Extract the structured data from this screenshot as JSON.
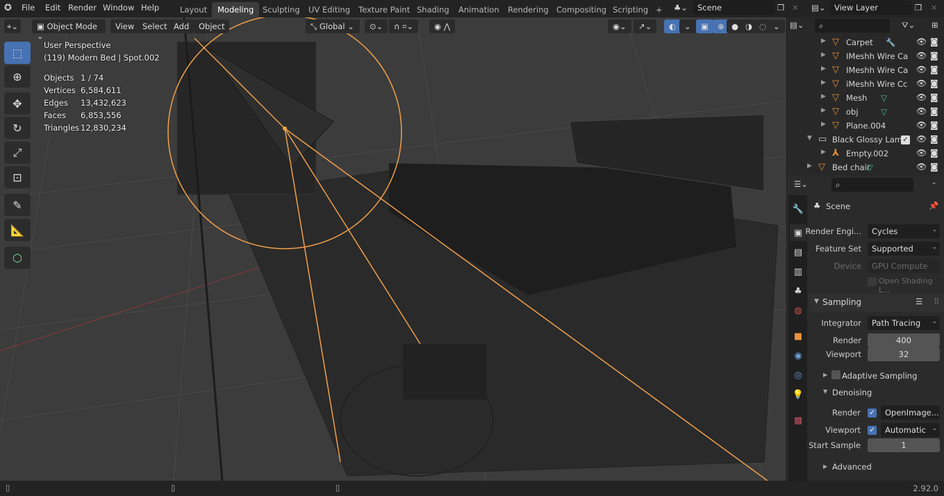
{
  "menu": {
    "items": [
      "File",
      "Edit",
      "Render",
      "Window",
      "Help"
    ]
  },
  "workspaces": {
    "tabs": [
      "Layout",
      "Modeling",
      "Sculpting",
      "UV Editing",
      "Texture Paint",
      "Shading",
      "Animation",
      "Rendering",
      "Compositing",
      "Scripting"
    ],
    "active": "Modeling",
    "add": "+"
  },
  "scene": {
    "name": "Scene",
    "view_layer": "View Layer"
  },
  "viewport_header": {
    "mode": "Object Mode",
    "view": "View",
    "select": "Select",
    "add": "Add",
    "object": "Object",
    "orientation": "Global"
  },
  "overlay": {
    "perspective": "User Perspective",
    "context": "(119) Modern Bed | Spot.002",
    "stats": [
      {
        "label": "Objects",
        "value": "1 / 74"
      },
      {
        "label": "Vertices",
        "value": "6,584,611"
      },
      {
        "label": "Edges",
        "value": "13,432,623"
      },
      {
        "label": "Faces",
        "value": "6,853,556"
      },
      {
        "label": "Triangles",
        "value": "12,830,234"
      }
    ]
  },
  "outliner": {
    "search_placeholder": "",
    "items": [
      {
        "label": "Carpet",
        "type": "mesh",
        "extra": "wrench"
      },
      {
        "label": "IMeshh Wire Ca",
        "type": "mesh"
      },
      {
        "label": "IMeshh Wire Ca",
        "type": "mesh"
      },
      {
        "label": "iMeshh Wire Cc",
        "type": "mesh"
      },
      {
        "label": "Mesh",
        "type": "mesh",
        "extra": "mesh-data"
      },
      {
        "label": "obj",
        "type": "mesh",
        "extra": "mesh-data"
      },
      {
        "label": "Plane.004",
        "type": "mesh"
      },
      {
        "label": "Black Glossy Lamp",
        "type": "collection",
        "checked": true
      },
      {
        "label": "Empty.002",
        "type": "empty"
      },
      {
        "label": "Bed chair",
        "type": "mesh",
        "extra": "mesh-data"
      }
    ]
  },
  "properties": {
    "context": "Scene",
    "render_engine": {
      "label": "Render Engi...",
      "value": "Cycles"
    },
    "feature_set": {
      "label": "Feature Set",
      "value": "Supported"
    },
    "device": {
      "label": "Device",
      "value": "GPU Compute"
    },
    "open_shading": {
      "label": "Open Shading L...",
      "checked": false
    },
    "sampling": {
      "title": "Sampling",
      "integrator_label": "Integrator",
      "integrator": "Path Tracing",
      "render_label": "Render",
      "render": "400",
      "viewport_label": "Viewport",
      "viewport": "32",
      "adaptive": {
        "label": "Adaptive Sampling",
        "checked": false
      },
      "denoising": {
        "title": "Denoising",
        "render_label": "Render",
        "render_checked": true,
        "render_value": "OpenImage...",
        "viewport_label": "Viewport",
        "viewport_checked": true,
        "viewport_value": "Automatic",
        "start_label": "Start Sample",
        "start_value": "1"
      },
      "advanced": "Advanced"
    }
  },
  "status": {
    "version": "2.92.0"
  },
  "colors": {
    "accent": "#4772b3",
    "light_selection": "#f0a04b",
    "object_icon": "#e8913a",
    "mesh_data": "#3fbf9f"
  }
}
